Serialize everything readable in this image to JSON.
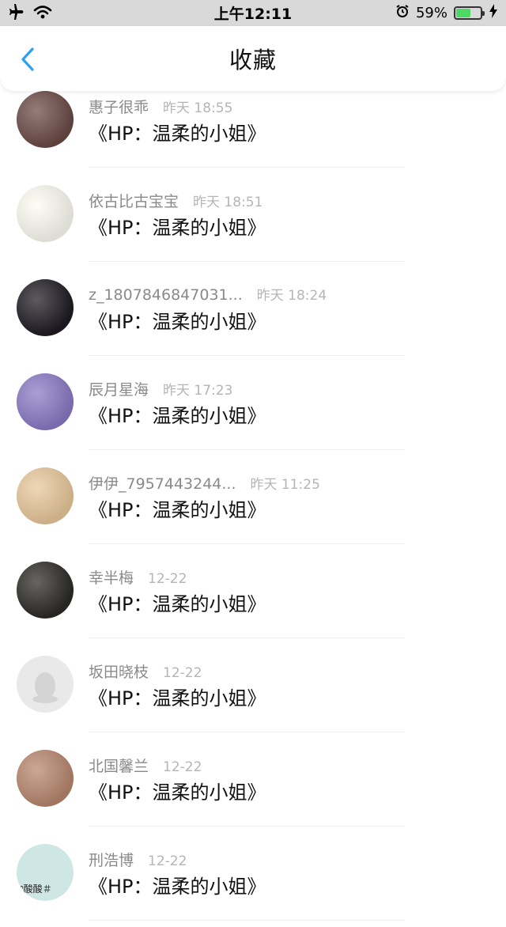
{
  "status_bar": {
    "time": "上午12:11",
    "battery_percent": "59%",
    "battery_level": 0.59,
    "icons": [
      "airplane-icon",
      "wifi-icon",
      "alarm-icon",
      "battery-icon",
      "charging-icon"
    ]
  },
  "nav": {
    "title": "收藏",
    "back_icon": "chevron-left-icon",
    "accent_color": "#2aa2f0"
  },
  "items": [
    {
      "username": "惠子很乖",
      "time": "昨天 18:55",
      "content": "《HP：温柔的小姐》",
      "avatar_color": "#6b4a45"
    },
    {
      "username": "依古比古宝宝",
      "time": "昨天 18:51",
      "content": "《HP：温柔的小姐》",
      "avatar_color": "#fcfbf2"
    },
    {
      "username": "z_1807846847031...",
      "time": "昨天 18:24",
      "content": "《HP：温柔的小姐》",
      "avatar_color": "#1e1a22"
    },
    {
      "username": "辰月星海",
      "time": "昨天 17:23",
      "content": "《HP：温柔的小姐》",
      "avatar_color": "#8a79c4"
    },
    {
      "username": "伊伊_7957443244...",
      "time": "昨天 11:25",
      "content": "《HP：温柔的小姐》",
      "avatar_color": "#e8c79a"
    },
    {
      "username": "幸半梅",
      "time": "12-22",
      "content": "《HP：温柔的小姐》",
      "avatar_color": "#2c2a26"
    },
    {
      "username": "坂田晓枝",
      "time": "12-22",
      "content": "《HP：温柔的小姐》",
      "avatar_color": "#e9e9e9"
    },
    {
      "username": "北国馨兰",
      "time": "12-22",
      "content": "《HP：温柔的小姐》",
      "avatar_color": "#b7866d"
    },
    {
      "username": "刑浩博",
      "time": "12-22",
      "content": "《HP：温柔的小姐》",
      "avatar_color": "#cfe7e4",
      "avatar_text": "ᐢ酸酸＃"
    }
  ]
}
